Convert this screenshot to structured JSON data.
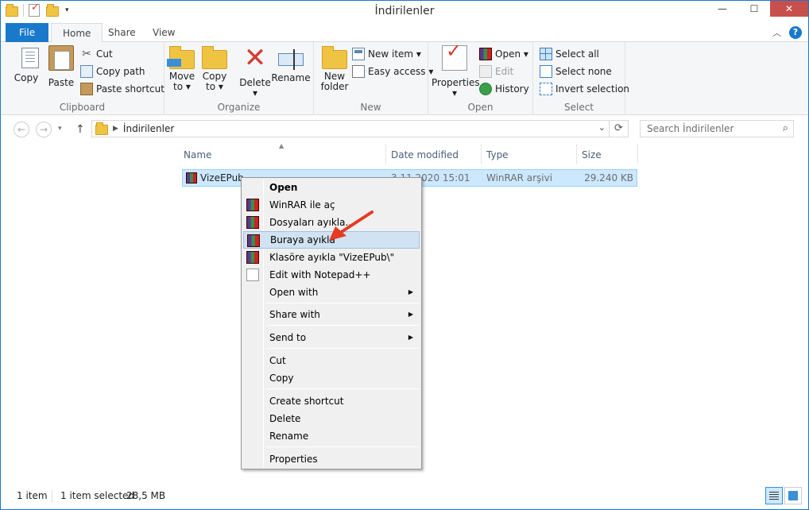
{
  "window": {
    "title": "İndirilenler",
    "minimize": "—",
    "maximize": "☐",
    "close": "✕"
  },
  "tabs": [
    {
      "label": "File"
    },
    {
      "label": "Home"
    },
    {
      "label": "Share"
    },
    {
      "label": "View"
    }
  ],
  "ribbon": {
    "clipboard": {
      "group": "Clipboard",
      "copy": "Copy",
      "paste": "Paste",
      "cut": "Cut",
      "copy_path": "Copy path",
      "paste_shortcut": "Paste shortcut"
    },
    "organize": {
      "group": "Organize",
      "move_to": "Move",
      "move_to2": "to ▾",
      "copy_to": "Copy",
      "copy_to2": "to ▾",
      "delete": "Delete",
      "delete2": "▾",
      "rename": "Rename"
    },
    "new": {
      "group": "New",
      "new_folder": "New",
      "new_folder2": "folder",
      "new_item": "New item ▾",
      "easy_access": "Easy access ▾"
    },
    "open": {
      "group": "Open",
      "properties": "Properties",
      "properties2": "▾",
      "open": "Open ▾",
      "edit": "Edit",
      "history": "History"
    },
    "select": {
      "group": "Select",
      "select_all": "Select all",
      "select_none": "Select none",
      "invert": "Invert selection"
    }
  },
  "address": {
    "back": "←",
    "forward": "→",
    "up": "↑",
    "path": "İndirilenler",
    "search_placeholder": "Search İndirilenler"
  },
  "columns": {
    "name": "Name",
    "date": "Date modified",
    "type": "Type",
    "size": "Size"
  },
  "file": {
    "name": "VizeEPub.",
    "date": "3.11.2020 15:01",
    "type": "WinRAR arşivi",
    "size": "29.240 KB"
  },
  "context_menu": {
    "items": [
      {
        "label": "Open"
      },
      {
        "label": "WinRAR ile aç"
      },
      {
        "label": "Dosyaları ayıkla..."
      },
      {
        "label": "Buraya ayıkla"
      },
      {
        "label": "Klasöre ayıkla \"VizeEPub\\\""
      },
      {
        "label": "Edit with Notepad++"
      },
      {
        "label": "Open with"
      },
      {
        "label": "Share with"
      },
      {
        "label": "Send to"
      },
      {
        "label": "Cut"
      },
      {
        "label": "Copy"
      },
      {
        "label": "Create shortcut"
      },
      {
        "label": "Delete"
      },
      {
        "label": "Rename"
      },
      {
        "label": "Properties"
      }
    ],
    "submenu_glyph": "▶"
  },
  "status": {
    "count": "1 item",
    "selected": "1 item selected",
    "size": "28,5 MB"
  },
  "colors": {
    "accent": "#1979ca",
    "highlight": "#cce8ff",
    "arrow": "#e53a23"
  }
}
